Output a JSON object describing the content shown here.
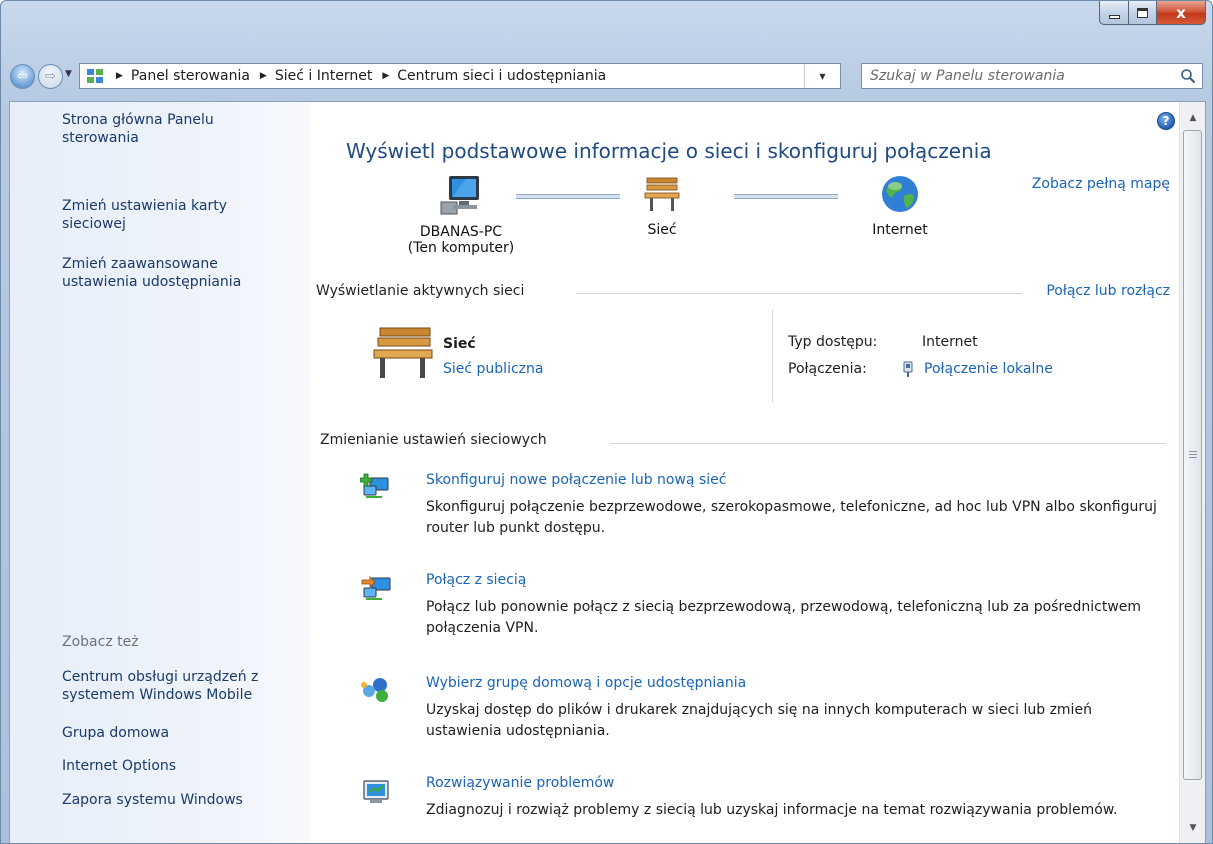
{
  "window": {
    "caption": {
      "minimize": "",
      "maximize": "",
      "close": "x"
    }
  },
  "navbar": {
    "back_glyph": "⇦",
    "forward_glyph": "⇨",
    "breadcrumbs": [
      "Panel sterowania",
      "Sieć i Internet",
      "Centrum sieci i udostępniania"
    ],
    "search_placeholder": "Szukaj w Panelu sterowania"
  },
  "sidebar": {
    "links": [
      {
        "label": "Strona główna Panelu sterowania"
      },
      {
        "label": "Zmień ustawienia karty sieciowej"
      },
      {
        "label": "Zmień zaawansowane ustawienia udostępniania"
      }
    ],
    "see_also_header": "Zobacz też",
    "see_also": [
      {
        "label": "Centrum obsługi urządzeń z systemem Windows Mobile"
      },
      {
        "label": "Grupa domowa"
      },
      {
        "label": "Internet Options"
      },
      {
        "label": "Zapora systemu Windows"
      }
    ]
  },
  "main": {
    "title": "Wyświetl podstawowe informacje o sieci i skonfiguruj połączenia",
    "map_link": "Zobacz pełną mapę",
    "map": {
      "computer_name": "DBANAS-PC",
      "computer_sub": "(Ten komputer)",
      "network_name": "Sieć",
      "internet_name": "Internet"
    },
    "active_section": {
      "header": "Wyświetlanie aktywnych sieci",
      "link": "Połącz lub rozłącz",
      "network_name": "Sieć",
      "network_type": "Sieć publiczna",
      "access_label": "Typ dostępu:",
      "access_value": "Internet",
      "connections_label": "Połączenia:",
      "connections_value": "Połączenie lokalne"
    },
    "change_section": {
      "header": "Zmienianie ustawień sieciowych",
      "tasks": [
        {
          "link": "Skonfiguruj nowe połączenie lub nową sieć",
          "desc": "Skonfiguruj połączenie bezprzewodowe, szerokopasmowe, telefoniczne, ad hoc lub VPN albo skonfiguruj router lub punkt dostępu.",
          "icon": "new-connection-icon"
        },
        {
          "link": "Połącz z siecią",
          "desc": "Połącz lub ponownie połącz z siecią bezprzewodową, przewodową, telefoniczną lub za pośrednictwem połączenia VPN.",
          "icon": "connect-network-icon"
        },
        {
          "link": "Wybierz grupę domową i opcje udostępniania",
          "desc": "Uzyskaj dostęp do plików i drukarek znajdujących się na innych komputerach w sieci lub zmień ustawienia udostępniania.",
          "icon": "homegroup-icon"
        },
        {
          "link": "Rozwiązywanie problemów",
          "desc": "Zdiagnozuj i rozwiąż problemy z siecią lub uzyskaj informacje na temat rozwiązywania problemów.",
          "icon": "troubleshoot-icon"
        }
      ]
    }
  },
  "help_glyph": "?"
}
